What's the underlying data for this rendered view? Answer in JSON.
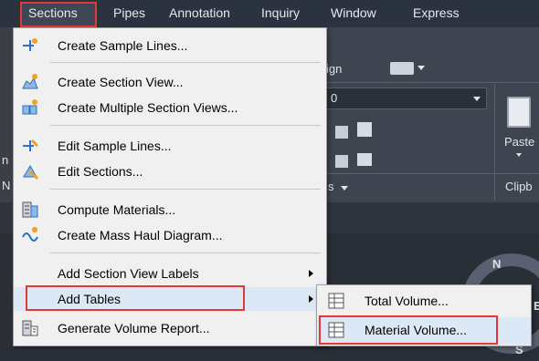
{
  "menubar": {
    "items": [
      "Sections",
      "Pipes",
      "Annotation",
      "Inquiry",
      "Window",
      "Express"
    ]
  },
  "ribbon": {
    "partial_tab": "ign",
    "dropdown_value": "0",
    "paste_label": "Paste",
    "clipboard_label": "Clipb",
    "panel_fragment": "s",
    "compass_letter": "N",
    "left_fragment_1": "n",
    "left_fragment_2": "N",
    "compass_letter_s": "S",
    "compass_letter_e": "E"
  },
  "menu": {
    "items": [
      {
        "label": "Create Sample Lines...",
        "icon": "sample-lines-icon"
      },
      {
        "label": "Create Section View...",
        "icon": "section-view-icon"
      },
      {
        "label": "Create Multiple Section Views...",
        "icon": "multiple-section-views-icon"
      },
      {
        "label": "Edit Sample Lines...",
        "icon": "edit-sample-lines-icon"
      },
      {
        "label": "Edit Sections...",
        "icon": "edit-sections-icon"
      },
      {
        "label": "Compute Materials...",
        "icon": "compute-materials-icon"
      },
      {
        "label": "Create Mass Haul Diagram...",
        "icon": "mass-haul-icon"
      },
      {
        "label": "Add Section View Labels",
        "icon": ""
      },
      {
        "label": "Add Tables",
        "icon": ""
      },
      {
        "label": "Generate Volume Report...",
        "icon": "volume-report-icon"
      }
    ]
  },
  "submenu": {
    "items": [
      {
        "label": "Total Volume...",
        "icon": "table-icon"
      },
      {
        "label": "Material Volume...",
        "icon": "table-icon"
      }
    ]
  },
  "colors": {
    "highlight": "#e53935",
    "menubar": "#2c3340",
    "hover": "#dce8f6"
  }
}
